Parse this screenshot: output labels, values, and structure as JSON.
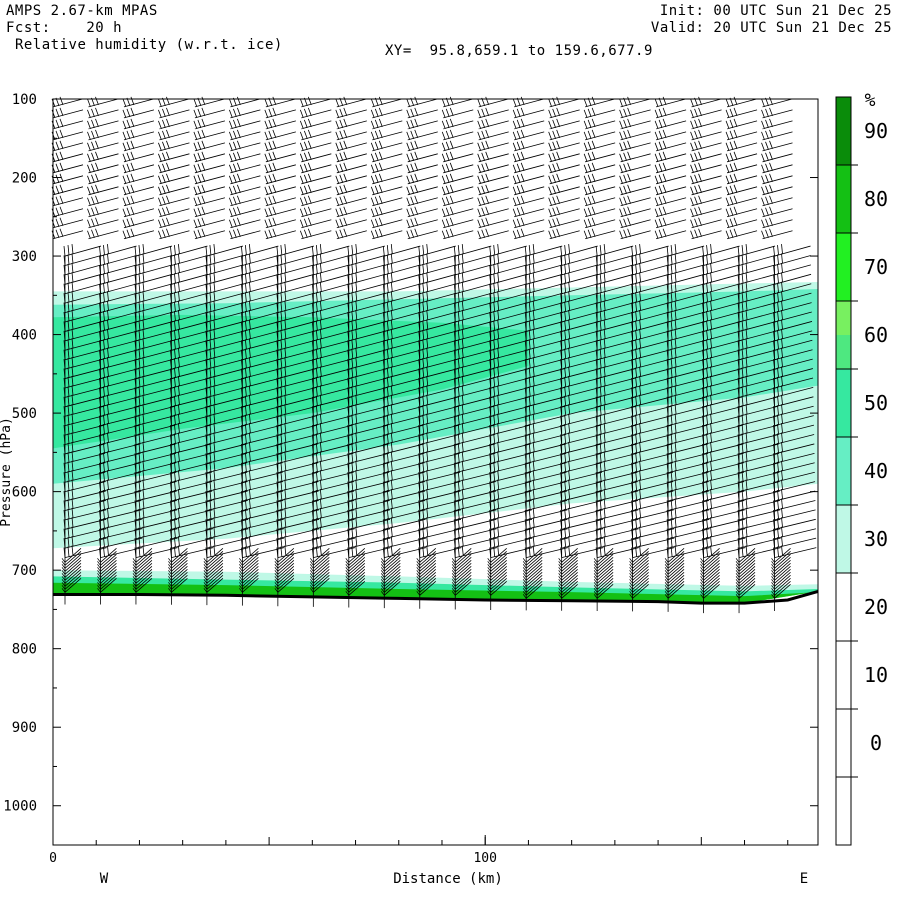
{
  "header": {
    "model": "AMPS 2.67-km MPAS",
    "fcst_label": "Fcst:",
    "fcst_value": "20 h",
    "field": "Relative humidity (w.r.t. ice)",
    "xy_label": "XY=",
    "xy_value": "95.8,659.1 to 159.6,677.9",
    "init_label": "Init:",
    "init_value": "00 UTC Sun 21 Dec 25",
    "valid_label": "Valid:",
    "valid_value": "20 UTC Sun 21 Dec 25"
  },
  "chart_data": {
    "type": "heatmap",
    "title": "Relative humidity (w.r.t. ice)",
    "xlabel": "Distance (km)",
    "ylabel": "Pressure (hPa)",
    "xlim": [
      0,
      177
    ],
    "ylim": [
      1050,
      100
    ],
    "x_ticks": [
      0,
      100
    ],
    "y_ticks": [
      100,
      200,
      300,
      400,
      500,
      600,
      700,
      800,
      900,
      1000
    ],
    "x_end_labels": {
      "left": "W",
      "right": "E"
    },
    "colorbar": {
      "unit": "%",
      "tick_labels": [
        0,
        10,
        20,
        30,
        40,
        50,
        60,
        70,
        80,
        90
      ],
      "bands": [
        {
          "from": -10,
          "to": 30,
          "color": "#ffffff"
        },
        {
          "from": 30,
          "to": 40,
          "color": "#bff8e6"
        },
        {
          "from": 40,
          "to": 50,
          "color": "#66eec4"
        },
        {
          "from": 50,
          "to": 60,
          "color": "#36e8a0"
        },
        {
          "from": 60,
          "to": 65,
          "color": "#4ee880"
        },
        {
          "from": 65,
          "to": 70,
          "color": "#78f060"
        },
        {
          "from": 70,
          "to": 80,
          "color": "#22f022"
        },
        {
          "from": 80,
          "to": 90,
          "color": "#14c014"
        },
        {
          "from": 90,
          "to": 100,
          "color": "#0a8c0a"
        }
      ]
    },
    "rh_layers": [
      {
        "level_min": 30,
        "x": [
          0,
          40,
          80,
          120,
          160,
          177
        ],
        "top": [
          345,
          345,
          345,
          340,
          335,
          333
        ],
        "bottom": [
          672,
          660,
          640,
          615,
          600,
          590
        ]
      },
      {
        "level_min": 40,
        "x": [
          0,
          40,
          80,
          120,
          160,
          177
        ],
        "top": [
          362,
          360,
          355,
          350,
          345,
          342
        ],
        "bottom": [
          590,
          570,
          540,
          500,
          480,
          465
        ]
      },
      {
        "level_min": 50,
        "x": [
          0,
          30,
          60,
          90,
          110
        ],
        "top": [
          378,
          375,
          378,
          385,
          395
        ],
        "bottom": [
          545,
          520,
          500,
          470,
          440
        ]
      },
      {
        "level_min": 30,
        "x": [
          0,
          40,
          80,
          120,
          160,
          177
        ],
        "top": [
          700,
          702,
          708,
          715,
          720,
          718
        ],
        "bottom": [
          731,
          732,
          736,
          740,
          742,
          727
        ]
      },
      {
        "level_min": 50,
        "x": [
          0,
          40,
          80,
          120,
          160,
          177
        ],
        "top": [
          708,
          712,
          716,
          722,
          727,
          724
        ],
        "bottom": [
          731,
          732,
          736,
          740,
          742,
          727
        ]
      },
      {
        "level_min": 80,
        "x": [
          0,
          40,
          80,
          120,
          160,
          177
        ],
        "top": [
          716,
          719,
          724,
          728,
          733,
          728
        ],
        "bottom": [
          731,
          732,
          736,
          740,
          742,
          727
        ]
      }
    ],
    "terrain_surface": {
      "x": [
        0,
        20,
        40,
        60,
        80,
        100,
        120,
        140,
        150,
        160,
        170,
        177
      ],
      "p": [
        731,
        731,
        732,
        734,
        736,
        738,
        739,
        740,
        742,
        742,
        738,
        727
      ]
    }
  }
}
